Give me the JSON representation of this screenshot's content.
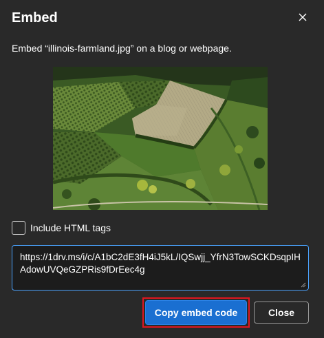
{
  "dialog": {
    "title": "Embed",
    "description": "Embed “illinois-farmland.jpg” on a blog or webpage.",
    "close_icon": "close-icon",
    "preview_alt": "illinois-farmland.jpg"
  },
  "options": {
    "include_html_label": "Include HTML tags",
    "include_html_checked": false
  },
  "embed_code": "https://1drv.ms/i/c/A1bC2dE3fH4iJ5kL/IQSwjj_YfrN3TowSCKDsqpIHAdowUVQeGZPRis9fDrEec4g",
  "buttons": {
    "copy_label": "Copy embed code",
    "close_label": "Close"
  },
  "colors": {
    "accent": "#1a6fd1",
    "highlight": "#e0161f",
    "background": "#292929"
  }
}
